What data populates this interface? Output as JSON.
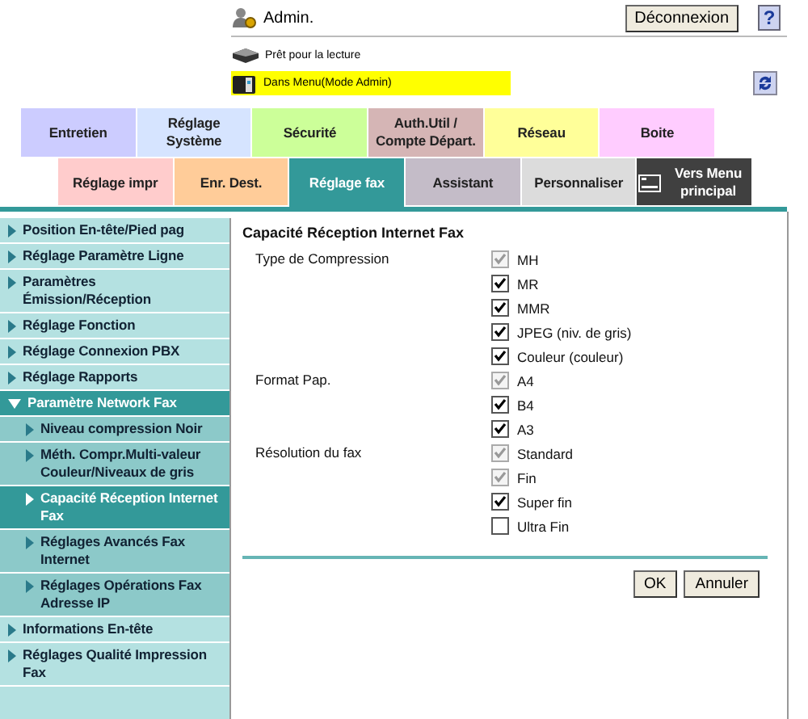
{
  "header": {
    "user": "Admin.",
    "logout_button": "Déconnexion",
    "help_button": "?",
    "status": "Prêt pour la lecture",
    "mode": "Dans Menu(Mode Admin)"
  },
  "tabs_row_1": [
    {
      "label": "Entretien",
      "color": "#ccccff",
      "selected": false
    },
    {
      "label": "Réglage Système",
      "color": "#d6e4ff",
      "selected": false
    },
    {
      "label": "Sécurité",
      "color": "#ccff99",
      "selected": false
    },
    {
      "label": "Auth.Util / Compte Départ.",
      "color": "#d5b5b5",
      "selected": false
    },
    {
      "label": "Réseau",
      "color": "#ffff99",
      "selected": false
    },
    {
      "label": "Boite",
      "color": "#ffccff",
      "selected": false
    }
  ],
  "tabs_row_2": [
    {
      "label": "Réglage impr",
      "color": "#ffcccc",
      "selected": false,
      "kind": "tab"
    },
    {
      "label": "Enr. Dest.",
      "color": "#ffcc99",
      "selected": false,
      "kind": "tab"
    },
    {
      "label": "Réglage fax",
      "color": "#339999",
      "selected": true,
      "kind": "tab"
    },
    {
      "label": "Assistant",
      "color": "#c4bcc8",
      "selected": false,
      "kind": "tab"
    },
    {
      "label": "Personnaliser",
      "color": "#dcdcdc",
      "selected": false,
      "kind": "tab"
    },
    {
      "label": "Vers Menu principal",
      "color": "#404040",
      "selected": false,
      "kind": "home"
    }
  ],
  "sidebar": {
    "items": [
      {
        "label": "Position En-tête/Pied pag",
        "selected": false,
        "expanded": false
      },
      {
        "label": "Réglage Paramètre Ligne",
        "selected": false,
        "expanded": false
      },
      {
        "label": "Paramètres Émission/Réception",
        "selected": false,
        "expanded": false
      },
      {
        "label": "Réglage Fonction",
        "selected": false,
        "expanded": false
      },
      {
        "label": "Réglage Connexion PBX",
        "selected": false,
        "expanded": false
      },
      {
        "label": "Réglage Rapports",
        "selected": false,
        "expanded": false
      },
      {
        "label": "Paramètre Network Fax",
        "selected": false,
        "expanded": true,
        "children": [
          {
            "label": "Niveau compression Noir",
            "selected": false
          },
          {
            "label": "Méth. Compr.Multi-valeur Couleur/Niveaux de gris",
            "selected": false
          },
          {
            "label": "Capacité Réception Internet Fax",
            "selected": true
          },
          {
            "label": "Réglages Avancés Fax Internet",
            "selected": false
          },
          {
            "label": "Réglages Opérations Fax Adresse IP",
            "selected": false
          }
        ]
      },
      {
        "label": "Informations En-tête",
        "selected": false,
        "expanded": false
      },
      {
        "label": "Réglages Qualité Impression Fax",
        "selected": false,
        "expanded": false
      }
    ]
  },
  "form": {
    "title": "Capacité Réception Internet Fax",
    "groups": [
      {
        "label": "Type de Compression",
        "options": [
          {
            "label": "MH",
            "checked": true,
            "disabled": true
          },
          {
            "label": "MR",
            "checked": true,
            "disabled": false
          },
          {
            "label": "MMR",
            "checked": true,
            "disabled": false
          },
          {
            "label": "JPEG (niv. de gris)",
            "checked": true,
            "disabled": false
          },
          {
            "label": "Couleur (couleur)",
            "checked": true,
            "disabled": false
          }
        ]
      },
      {
        "label": "Format Pap.",
        "options": [
          {
            "label": "A4",
            "checked": true,
            "disabled": true
          },
          {
            "label": "B4",
            "checked": true,
            "disabled": false
          },
          {
            "label": "A3",
            "checked": true,
            "disabled": false
          }
        ]
      },
      {
        "label": "Résolution du fax",
        "options": [
          {
            "label": "Standard",
            "checked": true,
            "disabled": true
          },
          {
            "label": "Fin",
            "checked": true,
            "disabled": true
          },
          {
            "label": "Super fin",
            "checked": true,
            "disabled": false
          },
          {
            "label": "Ultra Fin",
            "checked": false,
            "disabled": false
          }
        ]
      }
    ],
    "buttons": [
      "OK",
      "Annuler"
    ]
  }
}
